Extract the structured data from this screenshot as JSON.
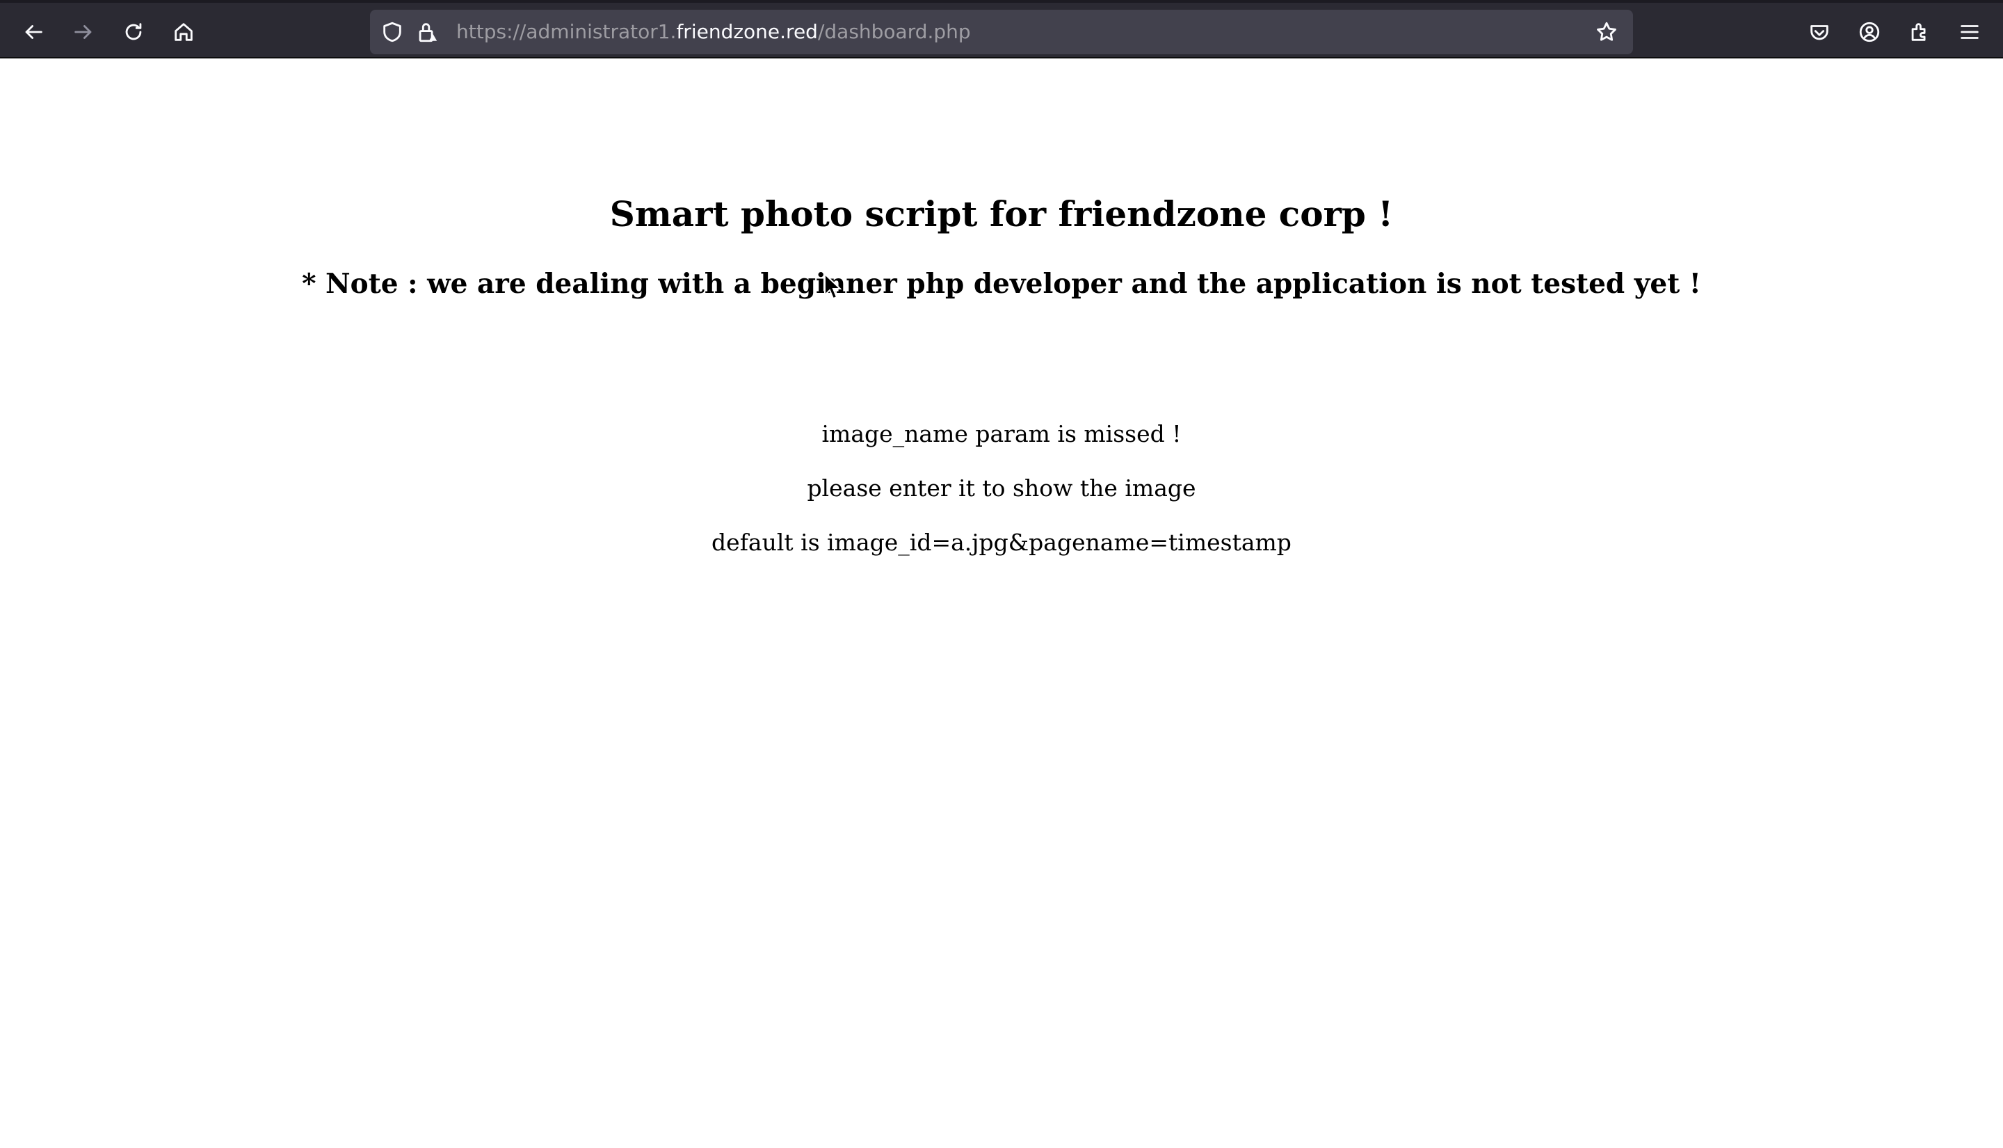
{
  "browser": {
    "url_prefix": "https://administrator1.",
    "url_domain": "friendzone.red",
    "url_path": "/dashboard.php",
    "icons": {
      "back": "back-arrow-icon",
      "forward": "forward-arrow-icon",
      "reload": "reload-icon",
      "home": "home-icon",
      "shield": "shield-icon",
      "lock": "lock-icon",
      "bookmark": "star-icon",
      "pocket": "pocket-icon",
      "account": "account-icon",
      "extensions": "extensions-icon",
      "menu": "hamburger-menu-icon"
    }
  },
  "page": {
    "title": "Smart photo script for friendzone corp !",
    "note": "* Note : we are dealing with a beginner php developer and the application is not tested yet !",
    "messages": [
      "image_name param is missed !",
      "please enter it to show the image",
      "default is image_id=a.jpg&pagename=timestamp"
    ]
  },
  "colors": {
    "toolbar_bg": "#2b2a33",
    "urlbar_bg": "#42414d",
    "page_bg": "#ffffff",
    "text": "#000000"
  }
}
